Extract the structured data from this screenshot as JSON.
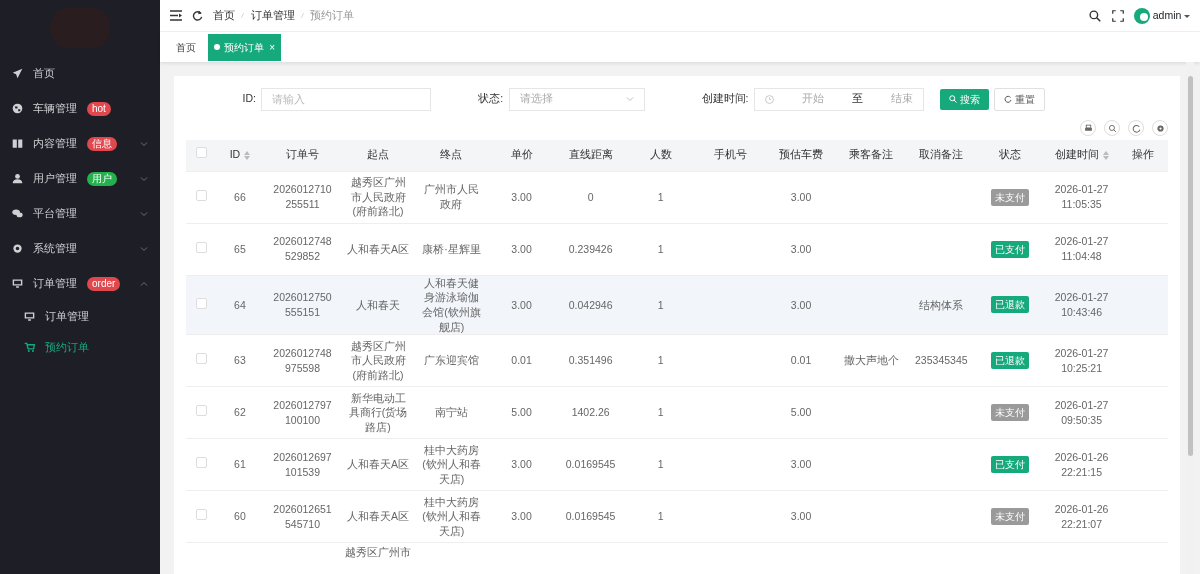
{
  "sidebar": {
    "items": [
      {
        "label": "首页",
        "selected": false
      },
      {
        "label": "车辆管理",
        "badge": "hot",
        "color": "#e0484e",
        "selected": false
      },
      {
        "label": "内容管理",
        "badge": "信息",
        "color": "#e0484e",
        "selected": false,
        "expanded": false
      },
      {
        "label": "用户管理",
        "badge": "用户",
        "color": "#22b14c",
        "selected": false,
        "expanded": false
      },
      {
        "label": "平台管理",
        "selected": false,
        "expanded": false
      },
      {
        "label": "系统管理",
        "selected": false,
        "expanded": false
      },
      {
        "label": "订单管理",
        "badge": "order",
        "color": "#e0484e",
        "selected": false,
        "expanded": true,
        "children": [
          {
            "label": "订单管理",
            "selected": false
          },
          {
            "label": "预约订单",
            "selected": true
          }
        ]
      }
    ]
  },
  "breadcrumb": [
    "首页",
    "订单管理",
    "预约订单"
  ],
  "user": {
    "name": "admin"
  },
  "tabs": [
    {
      "label": "首页",
      "selected": false
    },
    {
      "label": "预约订单",
      "selected": true,
      "close": "×"
    }
  ],
  "filters": {
    "id_label": "ID:",
    "id_placeholder": "请输入",
    "status_label": "状态:",
    "status_placeholder": "请选择",
    "time_label": "创建时间:",
    "time_start": "开始",
    "time_sep": "至",
    "time_end": "结束",
    "search_button": "搜索",
    "reset_button": "重置"
  },
  "table": {
    "select_all_checked": false,
    "columns": [
      "ID",
      "订单号",
      "起点",
      "终点",
      "单价",
      "直线距离",
      "人数",
      "手机号",
      "预估车费",
      "乘客备注",
      "取消备注",
      "状态",
      "创建时间",
      "操作"
    ],
    "rows": [
      {
        "id": "66",
        "order_no": "2026012710255511",
        "start": "越秀区广州市人民政府(府前路北)",
        "end": "广州市人民政府",
        "price": "3.00",
        "distance": "0",
        "people": "1",
        "fee": "3.00",
        "status": {
          "label": "未支付",
          "color": "#9a9a9a"
        },
        "created": "2026-01-27 11:05:35",
        "checked": false,
        "highlighted": false
      },
      {
        "id": "65",
        "order_no": "2026012748529852",
        "start": "人和春天A区",
        "end": "康桥·星辉里",
        "price": "3.00",
        "distance": "0.239426",
        "people": "1",
        "fee": "3.00",
        "status": {
          "label": "已支付",
          "color": "#16a97c"
        },
        "created": "2026-01-27 11:04:48",
        "checked": false,
        "highlighted": false
      },
      {
        "id": "64",
        "order_no": "2026012750555151",
        "start": "人和春天",
        "end": "人和春天健身游泳瑜伽会馆(钦州旗舰店)",
        "price": "3.00",
        "distance": "0.042946",
        "people": "1",
        "fee": "3.00",
        "cancel_note": "结构体系",
        "status": {
          "label": "已退款",
          "color": "#16a97c"
        },
        "created": "2026-01-27 10:43:46",
        "checked": false,
        "highlighted": true
      },
      {
        "id": "63",
        "order_no": "2026012748975598",
        "start": "越秀区广州市人民政府(府前路北)",
        "end": "广东迎宾馆",
        "price": "0.01",
        "distance": "0.351496",
        "people": "1",
        "fee": "0.01",
        "passenger_note": "撒大声地个",
        "cancel_note": "235345345",
        "status": {
          "label": "已退款",
          "color": "#16a97c"
        },
        "created": "2026-01-27 10:25:21",
        "checked": false,
        "highlighted": false
      },
      {
        "id": "62",
        "order_no": "2026012797100100",
        "start": "新华电动工具商行(货场路店)",
        "end": "南宁站",
        "price": "5.00",
        "distance": "1402.26",
        "people": "1",
        "fee": "5.00",
        "status": {
          "label": "未支付",
          "color": "#9a9a9a"
        },
        "created": "2026-01-27 09:50:35",
        "checked": false,
        "highlighted": false
      },
      {
        "id": "61",
        "order_no": "2026012697101539",
        "start": "人和春天A区",
        "end": "桂中大药房(钦州人和春天店)",
        "price": "3.00",
        "distance": "0.0169545",
        "people": "1",
        "fee": "3.00",
        "status": {
          "label": "已支付",
          "color": "#16a97c"
        },
        "created": "2026-01-26 22:21:15",
        "checked": false,
        "highlighted": false
      },
      {
        "id": "60",
        "order_no": "2026012651545710",
        "start": "人和春天A区",
        "end": "桂中大药房(钦州人和春天店)",
        "price": "3.00",
        "distance": "0.0169545",
        "people": "1",
        "fee": "3.00",
        "status": {
          "label": "未支付",
          "color": "#9a9a9a"
        },
        "created": "2026-01-26 22:21:07",
        "checked": false,
        "highlighted": false
      }
    ],
    "partial_row": {
      "start": "越秀区广州市"
    }
  }
}
